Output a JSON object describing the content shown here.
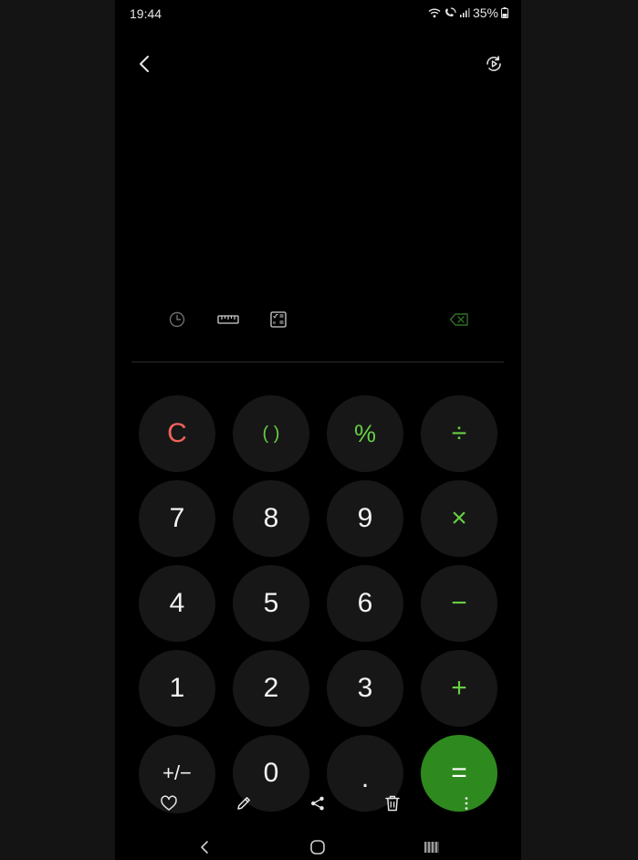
{
  "status_bar": {
    "time": "19:44",
    "battery": "35%",
    "icons": [
      "wifi-icon",
      "wifi-call-icon",
      "signal-icon",
      "battery-icon"
    ]
  },
  "header": {
    "icons": [
      "back-icon",
      "rotate-screen-icon"
    ]
  },
  "tools": {
    "icons": [
      "history-icon",
      "ruler-icon",
      "scientific-icon",
      "backspace-icon"
    ]
  },
  "keypad": {
    "rows": [
      [
        {
          "label": "C",
          "name": "clear-button"
        },
        {
          "label": "( )",
          "name": "parentheses-button"
        },
        {
          "label": "%",
          "name": "percent-button"
        },
        {
          "label": "÷",
          "name": "divide-button"
        }
      ],
      [
        {
          "label": "7",
          "name": "digit-7-button"
        },
        {
          "label": "8",
          "name": "digit-8-button"
        },
        {
          "label": "9",
          "name": "digit-9-button"
        },
        {
          "label": "×",
          "name": "multiply-button"
        }
      ],
      [
        {
          "label": "4",
          "name": "digit-4-button"
        },
        {
          "label": "5",
          "name": "digit-5-button"
        },
        {
          "label": "6",
          "name": "digit-6-button"
        },
        {
          "label": "−",
          "name": "minus-button"
        }
      ],
      [
        {
          "label": "1",
          "name": "digit-1-button"
        },
        {
          "label": "2",
          "name": "digit-2-button"
        },
        {
          "label": "3",
          "name": "digit-3-button"
        },
        {
          "label": "+",
          "name": "plus-button"
        }
      ],
      [
        {
          "label": "+/−",
          "name": "plus-minus-button"
        },
        {
          "label": "0",
          "name": "digit-0-button"
        },
        {
          "label": ".",
          "name": "decimal-button"
        },
        {
          "label": "=",
          "name": "equals-button"
        }
      ]
    ]
  },
  "action_bar": {
    "icons": [
      "heart-icon",
      "pencil-icon",
      "share-icon",
      "trash-icon",
      "more-vertical-icon"
    ]
  },
  "nav_bar": {
    "icons": [
      "nav-back-icon",
      "nav-home-icon",
      "nav-recents-icon"
    ]
  },
  "colors": {
    "background": "#000000",
    "key_background": "#171717",
    "accent_green": "#66cf44",
    "equals_background": "#2e8a1e",
    "clear_red": "#f0625b"
  }
}
